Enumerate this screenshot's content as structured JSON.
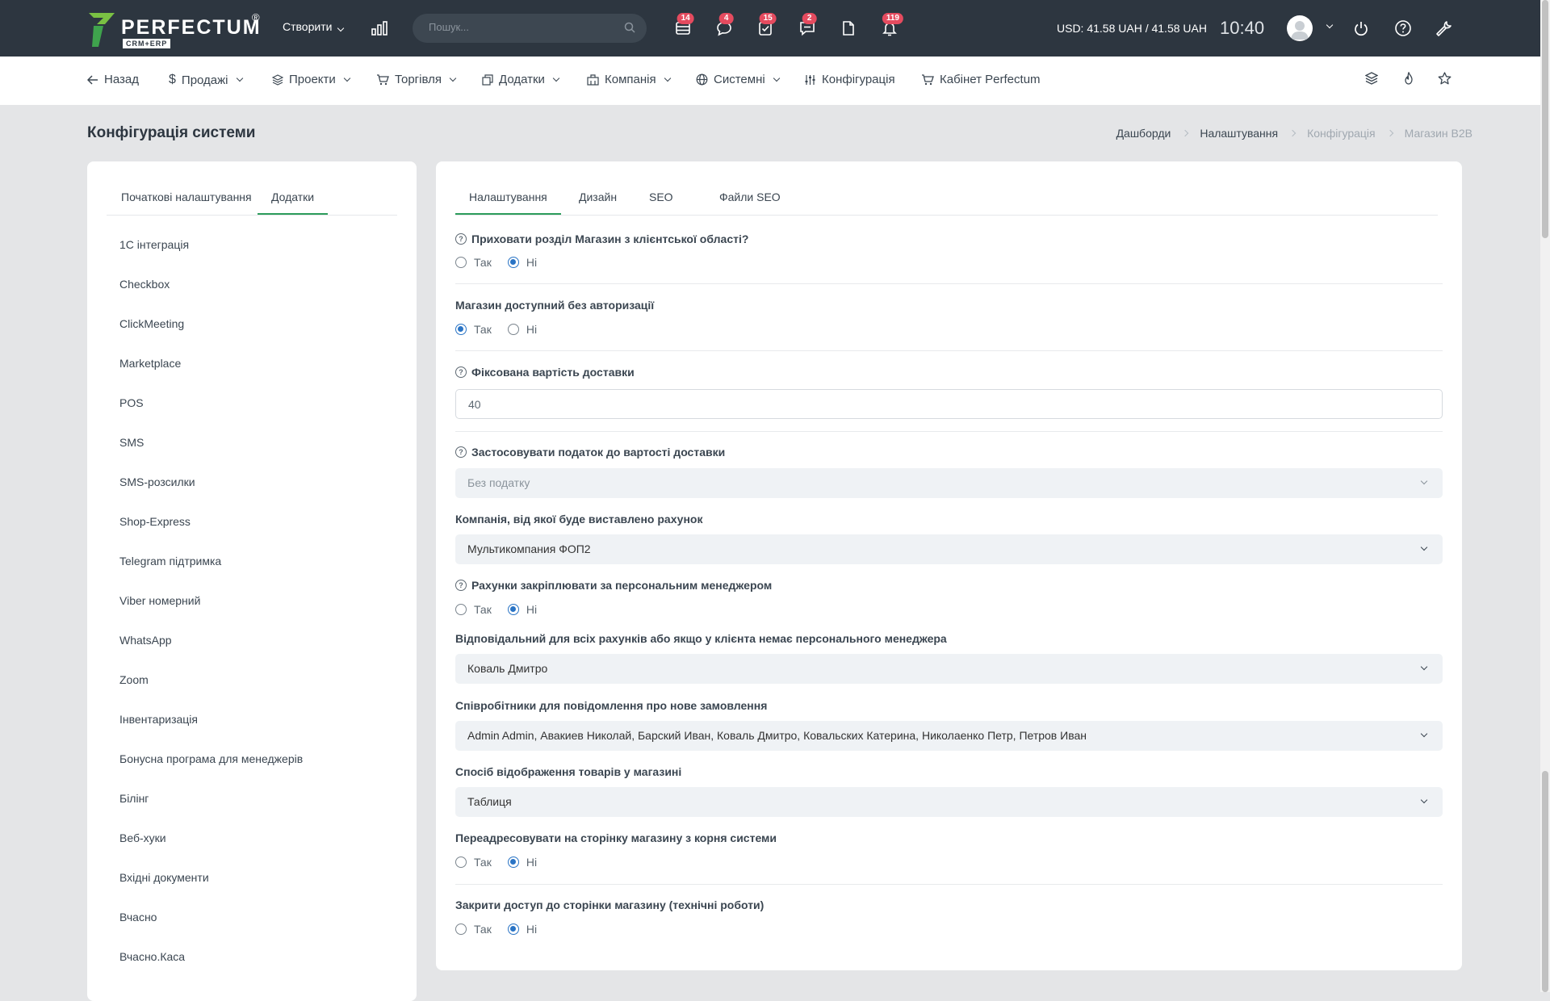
{
  "topbar": {
    "logo_text": "PERFECTUM",
    "logo_reg": "®",
    "logo_sub": "CRM+ERP",
    "create_label": "Створити",
    "search_placeholder": "Пошук...",
    "badges": {
      "tasks_table": "14",
      "chat": "4",
      "checklist": "15",
      "messages": "2",
      "notifications": "119"
    },
    "currency": "USD: 41.58 UAH / 41.58 UAH",
    "time": "10:40"
  },
  "nav": {
    "back": "Назад",
    "sales": "Продажі",
    "projects": "Проекти",
    "trade": "Торгівля",
    "addons": "Додатки",
    "company": "Компанія",
    "system": "Системні",
    "config": "Конфігурація",
    "cabinet": "Кабінет Perfectum"
  },
  "page": {
    "title": "Конфігурація системи",
    "breadcrumbs": [
      "Дашборди",
      "Налаштування",
      "Конфігурація",
      "Магазин B2B"
    ]
  },
  "left": {
    "tabs": [
      "Початкові налаштування",
      "Додатки"
    ],
    "items": [
      "1С інтеграція",
      "Checkbox",
      "ClickMeeting",
      "Marketplace",
      "POS",
      "SMS",
      "SMS-розсилки",
      "Shop-Express",
      "Telegram підтримка",
      "Viber номерний",
      "WhatsApp",
      "Zoom",
      "Інвентаризація",
      "Бонусна програма для менеджерів",
      "Білінг",
      "Веб-хуки",
      "Вхідні документи",
      "Вчасно",
      "Вчасно.Каса"
    ]
  },
  "right": {
    "tabs": [
      "Налаштування",
      "Дизайн",
      "SEO",
      "Файли SEO"
    ],
    "yes": "Так",
    "no": "Ні",
    "fields": {
      "hide_shop": "Приховати розділ Магазин з клієнтської області?",
      "no_auth": "Магазин доступний без авторизації",
      "fixed_delivery": "Фіксована вартість доставки",
      "fixed_delivery_value": "40",
      "tax_delivery": "Застосовувати податок до вартості доставки",
      "tax_delivery_value": "Без податку",
      "invoice_company": "Компанія, від якої буде виставлено рахунок",
      "invoice_company_value": "Мультикомпания ФОП2",
      "assign_manager": "Рахунки закріплювати за персональним менеджером",
      "responsible": "Відповідальний для всіх рахунків або якщо у клієнта немає персонального менеджера",
      "responsible_value": "Коваль Дмитро",
      "notify_staff": "Співробітники для повідомлення про нове замовлення",
      "notify_staff_value": "Admin Admin, Авакиев Николай, Барский Иван, Коваль Дмитро, Ковальских Катерина, Николаенко Петр, Петров Иван",
      "display_mode": "Спосіб відображення товарів у магазині",
      "display_mode_value": "Таблиця",
      "redirect_root": "Переадресовувати на сторінку магазину з корня системи",
      "close_access": "Закрити доступ до сторінки магазину (технічні роботи)"
    }
  }
}
